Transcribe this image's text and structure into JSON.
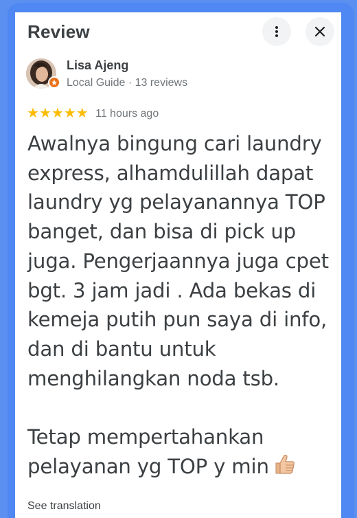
{
  "header": {
    "title": "Review",
    "more_icon": "more-vert-icon",
    "close_icon": "close-icon"
  },
  "reviewer": {
    "name": "Lisa Ajeng",
    "meta": "Local Guide · 13 reviews",
    "badge_icon": "local-guide-badge-icon"
  },
  "rating": {
    "stars": 5,
    "max_stars": 5,
    "time_ago": "11 hours ago"
  },
  "review": {
    "text": "Awalnya bingung cari laundry express, alhamdulillah dapat laundry yg pelayanannya TOP banget, dan bisa di pick up juga. Pengerjaannya juga cpet bgt. 3 jam jadi . Ada bekas di kemeja putih pun saya di info, dan di bantu untuk menghilangkan noda tsb.\n\nTetap mempertahankan pelayanan yg TOP y min",
    "emoji_icon": "thumbs-up-icon"
  },
  "footer": {
    "see_translation": "See translation"
  },
  "colors": {
    "background": "#4f88f2",
    "panel": "#ffffff",
    "star": "#fbbc04",
    "badge": "#e8711b",
    "text_primary": "#3c4043",
    "text_secondary": "#70757a"
  }
}
